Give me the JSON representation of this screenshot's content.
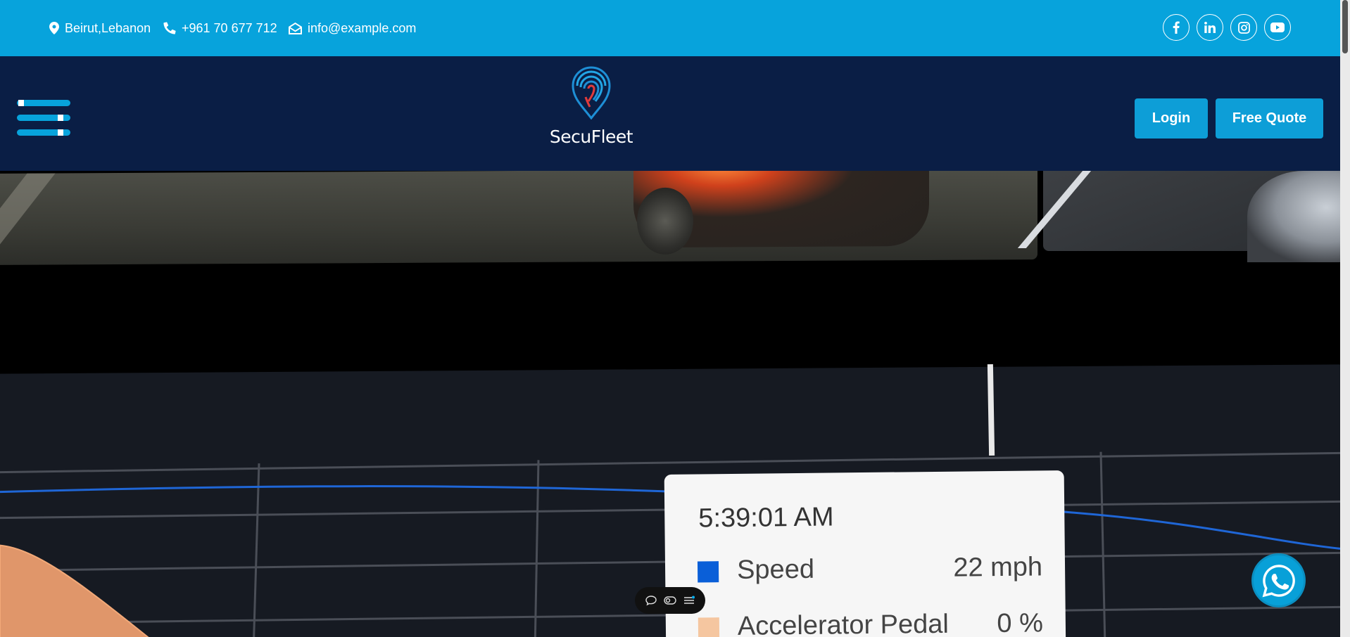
{
  "topbar": {
    "address": "Beirut,Lebanon",
    "phone": "+961 70 677 712",
    "email": "info@example.com",
    "social": [
      "facebook-icon",
      "linkedin-icon",
      "instagram-icon",
      "youtube-icon"
    ]
  },
  "header": {
    "brand": "SecuFleet",
    "login_label": "Login",
    "quote_label": "Free Quote"
  },
  "tooltip": {
    "time": "5:39:01 AM",
    "rows": [
      {
        "name": "Speed",
        "value": "22 mph",
        "color": "#0a5fd8"
      },
      {
        "name": "Accelerator Pedal",
        "value": "0 %",
        "color": "#f5c6a0"
      }
    ]
  },
  "colors": {
    "accent": "#07a3dc",
    "header_bg": "#0a1e45",
    "speed_line": "#1f66d6",
    "pedal_area": "#e0966a"
  }
}
